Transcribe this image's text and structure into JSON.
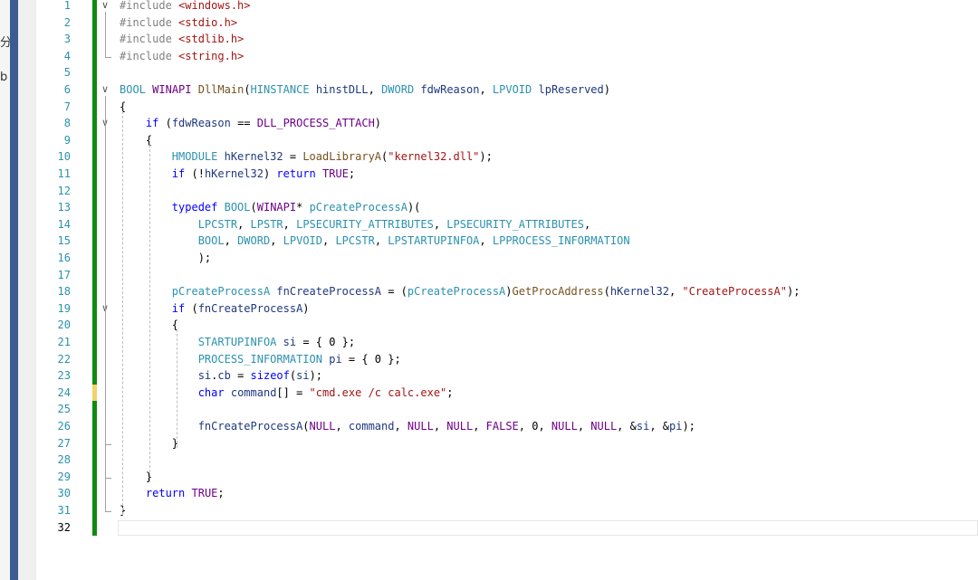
{
  "left_panel": {
    "fragments": [
      "分",
      "b"
    ]
  },
  "editor": {
    "current_line": 32,
    "modified_line": 24,
    "lines": [
      {
        "n": "1",
        "fold": "∨",
        "tokens": [
          [
            "pp",
            "#include "
          ],
          [
            "inc",
            "<windows.h>"
          ]
        ]
      },
      {
        "n": "2",
        "fold": "",
        "tokens": [
          [
            "pp",
            "#include "
          ],
          [
            "inc",
            "<stdio.h>"
          ]
        ]
      },
      {
        "n": "3",
        "fold": "",
        "tokens": [
          [
            "pp",
            "#include "
          ],
          [
            "inc",
            "<stdlib.h>"
          ]
        ]
      },
      {
        "n": "4",
        "fold": "",
        "tokens": [
          [
            "pp",
            "#include "
          ],
          [
            "inc",
            "<string.h>"
          ]
        ]
      },
      {
        "n": "5",
        "fold": "",
        "tokens": []
      },
      {
        "n": "6",
        "fold": "∨",
        "tokens": [
          [
            "ty",
            "BOOL"
          ],
          [
            "plain",
            " "
          ],
          [
            "mac",
            "WINAPI"
          ],
          [
            "plain",
            " "
          ],
          [
            "fn",
            "DllMain"
          ],
          [
            "plain",
            "("
          ],
          [
            "ty",
            "HINSTANCE"
          ],
          [
            "plain",
            " "
          ],
          [
            "var",
            "hinstDLL"
          ],
          [
            "plain",
            ", "
          ],
          [
            "ty",
            "DWORD"
          ],
          [
            "plain",
            " "
          ],
          [
            "var",
            "fdwReason"
          ],
          [
            "plain",
            ", "
          ],
          [
            "ty",
            "LPVOID"
          ],
          [
            "plain",
            " "
          ],
          [
            "var",
            "lpReserved"
          ],
          [
            "plain",
            ")"
          ]
        ]
      },
      {
        "n": "7",
        "fold": "",
        "tokens": [
          [
            "plain",
            "{"
          ]
        ]
      },
      {
        "n": "8",
        "fold": "∨",
        "tokens": [
          [
            "plain",
            "    "
          ],
          [
            "kw",
            "if"
          ],
          [
            "plain",
            " ("
          ],
          [
            "var",
            "fdwReason"
          ],
          [
            "plain",
            " == "
          ],
          [
            "mac",
            "DLL_PROCESS_ATTACH"
          ],
          [
            "plain",
            ")"
          ]
        ]
      },
      {
        "n": "9",
        "fold": "",
        "tokens": [
          [
            "plain",
            "    {"
          ]
        ]
      },
      {
        "n": "10",
        "fold": "",
        "tokens": [
          [
            "plain",
            "        "
          ],
          [
            "ty",
            "HMODULE"
          ],
          [
            "plain",
            " "
          ],
          [
            "var",
            "hKernel32"
          ],
          [
            "plain",
            " = "
          ],
          [
            "fn",
            "LoadLibraryA"
          ],
          [
            "plain",
            "("
          ],
          [
            "str",
            "\"kernel32.dll\""
          ],
          [
            "plain",
            ");"
          ]
        ]
      },
      {
        "n": "11",
        "fold": "",
        "tokens": [
          [
            "plain",
            "        "
          ],
          [
            "kw",
            "if"
          ],
          [
            "plain",
            " (!"
          ],
          [
            "var",
            "hKernel32"
          ],
          [
            "plain",
            ") "
          ],
          [
            "kw",
            "return"
          ],
          [
            "plain",
            " "
          ],
          [
            "mac",
            "TRUE"
          ],
          [
            "plain",
            ";"
          ]
        ]
      },
      {
        "n": "12",
        "fold": "",
        "tokens": []
      },
      {
        "n": "13",
        "fold": "",
        "tokens": [
          [
            "plain",
            "        "
          ],
          [
            "kw",
            "typedef"
          ],
          [
            "plain",
            " "
          ],
          [
            "ty",
            "BOOL"
          ],
          [
            "plain",
            "("
          ],
          [
            "mac",
            "WINAPI"
          ],
          [
            "plain",
            "* "
          ],
          [
            "ty",
            "pCreateProcessA"
          ],
          [
            "plain",
            ")("
          ]
        ]
      },
      {
        "n": "14",
        "fold": "",
        "tokens": [
          [
            "plain",
            "            "
          ],
          [
            "ty",
            "LPCSTR"
          ],
          [
            "plain",
            ", "
          ],
          [
            "ty",
            "LPSTR"
          ],
          [
            "plain",
            ", "
          ],
          [
            "ty",
            "LPSECURITY_ATTRIBUTES"
          ],
          [
            "plain",
            ", "
          ],
          [
            "ty",
            "LPSECURITY_ATTRIBUTES"
          ],
          [
            "plain",
            ","
          ]
        ]
      },
      {
        "n": "15",
        "fold": "",
        "tokens": [
          [
            "plain",
            "            "
          ],
          [
            "ty",
            "BOOL"
          ],
          [
            "plain",
            ", "
          ],
          [
            "ty",
            "DWORD"
          ],
          [
            "plain",
            ", "
          ],
          [
            "ty",
            "LPVOID"
          ],
          [
            "plain",
            ", "
          ],
          [
            "ty",
            "LPCSTR"
          ],
          [
            "plain",
            ", "
          ],
          [
            "ty",
            "LPSTARTUPINFOA"
          ],
          [
            "plain",
            ", "
          ],
          [
            "ty",
            "LPPROCESS_INFORMATION"
          ]
        ]
      },
      {
        "n": "16",
        "fold": "",
        "tokens": [
          [
            "plain",
            "            );"
          ]
        ]
      },
      {
        "n": "17",
        "fold": "",
        "tokens": []
      },
      {
        "n": "18",
        "fold": "",
        "tokens": [
          [
            "plain",
            "        "
          ],
          [
            "ty",
            "pCreateProcessA"
          ],
          [
            "plain",
            " "
          ],
          [
            "var",
            "fnCreateProcessA"
          ],
          [
            "plain",
            " = ("
          ],
          [
            "ty",
            "pCreateProcessA"
          ],
          [
            "plain",
            ")"
          ],
          [
            "fn",
            "GetProcAddress"
          ],
          [
            "plain",
            "("
          ],
          [
            "var",
            "hKernel32"
          ],
          [
            "plain",
            ", "
          ],
          [
            "str",
            "\"CreateProcessA\""
          ],
          [
            "plain",
            ");"
          ]
        ]
      },
      {
        "n": "19",
        "fold": "∨",
        "tokens": [
          [
            "plain",
            "        "
          ],
          [
            "kw",
            "if"
          ],
          [
            "plain",
            " ("
          ],
          [
            "var",
            "fnCreateProcessA"
          ],
          [
            "plain",
            ")"
          ]
        ]
      },
      {
        "n": "20",
        "fold": "",
        "tokens": [
          [
            "plain",
            "        {"
          ]
        ]
      },
      {
        "n": "21",
        "fold": "",
        "tokens": [
          [
            "plain",
            "            "
          ],
          [
            "ty",
            "STARTUPINFOA"
          ],
          [
            "plain",
            " "
          ],
          [
            "var",
            "si"
          ],
          [
            "plain",
            " = { "
          ],
          [
            "num",
            "0"
          ],
          [
            "plain",
            " };"
          ]
        ]
      },
      {
        "n": "22",
        "fold": "",
        "tokens": [
          [
            "plain",
            "            "
          ],
          [
            "ty",
            "PROCESS_INFORMATION"
          ],
          [
            "plain",
            " "
          ],
          [
            "var",
            "pi"
          ],
          [
            "plain",
            " = { "
          ],
          [
            "num",
            "0"
          ],
          [
            "plain",
            " };"
          ]
        ]
      },
      {
        "n": "23",
        "fold": "",
        "tokens": [
          [
            "plain",
            "            "
          ],
          [
            "var",
            "si"
          ],
          [
            "plain",
            "."
          ],
          [
            "var",
            "cb"
          ],
          [
            "plain",
            " = "
          ],
          [
            "kw",
            "sizeof"
          ],
          [
            "plain",
            "("
          ],
          [
            "var",
            "si"
          ],
          [
            "plain",
            ");"
          ]
        ]
      },
      {
        "n": "24",
        "fold": "",
        "tokens": [
          [
            "plain",
            "            "
          ],
          [
            "kw",
            "char"
          ],
          [
            "plain",
            " "
          ],
          [
            "var",
            "command"
          ],
          [
            "plain",
            "[] = "
          ],
          [
            "str",
            "\"cmd.exe /c calc.exe\""
          ],
          [
            "plain",
            ";"
          ]
        ]
      },
      {
        "n": "25",
        "fold": "",
        "tokens": []
      },
      {
        "n": "26",
        "fold": "",
        "tokens": [
          [
            "plain",
            "            "
          ],
          [
            "var",
            "fnCreateProcessA"
          ],
          [
            "plain",
            "("
          ],
          [
            "mac",
            "NULL"
          ],
          [
            "plain",
            ", "
          ],
          [
            "var",
            "command"
          ],
          [
            "plain",
            ", "
          ],
          [
            "mac",
            "NULL"
          ],
          [
            "plain",
            ", "
          ],
          [
            "mac",
            "NULL"
          ],
          [
            "plain",
            ", "
          ],
          [
            "mac",
            "FALSE"
          ],
          [
            "plain",
            ", "
          ],
          [
            "num",
            "0"
          ],
          [
            "plain",
            ", "
          ],
          [
            "mac",
            "NULL"
          ],
          [
            "plain",
            ", "
          ],
          [
            "mac",
            "NULL"
          ],
          [
            "plain",
            ", &"
          ],
          [
            "var",
            "si"
          ],
          [
            "plain",
            ", &"
          ],
          [
            "var",
            "pi"
          ],
          [
            "plain",
            ");"
          ]
        ]
      },
      {
        "n": "27",
        "fold": "",
        "tokens": [
          [
            "plain",
            "        }"
          ]
        ]
      },
      {
        "n": "28",
        "fold": "",
        "tokens": []
      },
      {
        "n": "29",
        "fold": "",
        "tokens": [
          [
            "plain",
            "    }"
          ]
        ]
      },
      {
        "n": "30",
        "fold": "",
        "tokens": [
          [
            "plain",
            "    "
          ],
          [
            "kw",
            "return"
          ],
          [
            "plain",
            " "
          ],
          [
            "mac",
            "TRUE"
          ],
          [
            "plain",
            ";"
          ]
        ]
      },
      {
        "n": "31",
        "fold": "",
        "tokens": [
          [
            "plain",
            "}"
          ]
        ]
      },
      {
        "n": "32",
        "fold": "",
        "tokens": []
      }
    ]
  }
}
